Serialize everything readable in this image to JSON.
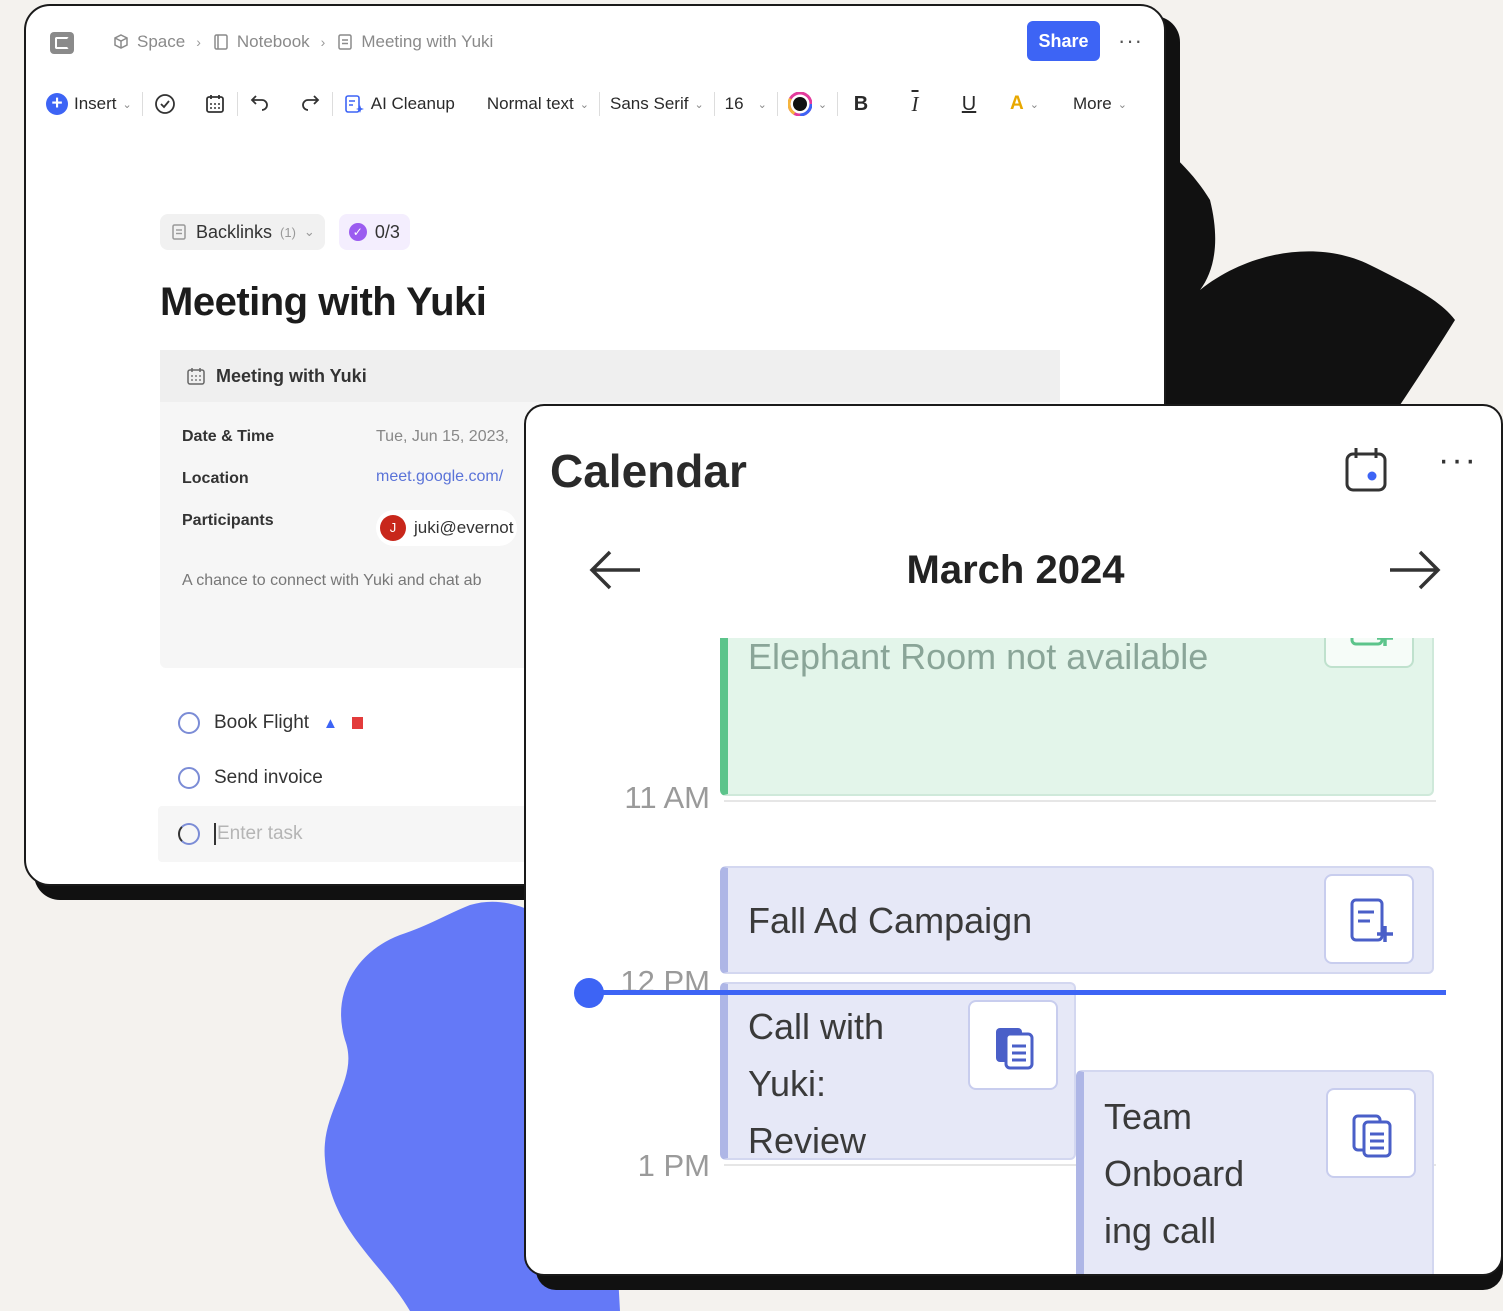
{
  "colors": {
    "accent": "#3d64f5",
    "decor_blue": "#6479f7",
    "decor_black": "#111111"
  },
  "notes": {
    "breadcrumb": [
      {
        "label": "Space",
        "icon": "cube-icon"
      },
      {
        "label": "Notebook",
        "icon": "notebook-icon"
      },
      {
        "label": "Meeting with Yuki",
        "icon": "note-icon"
      }
    ],
    "share_label": "Share",
    "more_label": "···",
    "toolbar": {
      "insert": "Insert",
      "ai_cleanup": "AI Cleanup",
      "text_style": "Normal text",
      "font": "Sans Serif",
      "size": "16",
      "more": "More"
    },
    "backlinks_label": "Backlinks",
    "backlinks_count": "(1)",
    "tasks_progress": "0/3",
    "title": "Meeting with Yuki",
    "event_card": {
      "title": "Meeting with Yuki",
      "date_label": "Date & Time",
      "date_value": "Tue, Jun 15, 2023,",
      "location_label": "Location",
      "location_value": "meet.google.com/",
      "participants_label": "Participants",
      "participant_initial": "J",
      "participant_email": "juki@evernot",
      "description": "A chance to connect with Yuki and chat ab"
    },
    "tasks": [
      {
        "label": "Book Flight"
      },
      {
        "label": "Send invoice"
      }
    ],
    "task_placeholder": "Enter task"
  },
  "calendar": {
    "title": "Calendar",
    "month": "March 2024",
    "more_label": "···",
    "times": [
      "11 AM",
      "12 PM",
      "1 PM"
    ],
    "events": [
      {
        "title": "Elephant Room not available"
      },
      {
        "title": "Fall Ad Campaign"
      },
      {
        "title_lines": [
          "Call with",
          "Yuki:",
          "Review"
        ]
      },
      {
        "title_lines": [
          "Team",
          "Onboard",
          "ing call"
        ]
      }
    ]
  }
}
